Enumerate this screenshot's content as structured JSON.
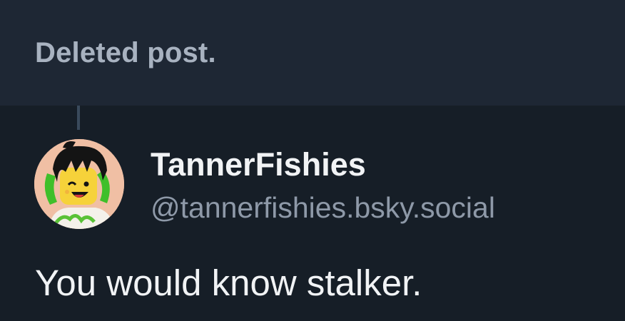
{
  "parent_post": {
    "deleted_label": "Deleted post."
  },
  "reply": {
    "author": {
      "display_name": "TannerFishies",
      "handle": "@tannerfishies.bsky.social",
      "avatar_icon": "lego-minifigure-avatar"
    },
    "text": "You would know stalker."
  },
  "colors": {
    "background": "#161e27",
    "deleted_bar": "#1e2734",
    "deleted_text": "#a8b2c0",
    "primary_text": "#f1f3f5",
    "secondary_text": "#8e99a8",
    "thread_line": "#3a4a5c"
  }
}
